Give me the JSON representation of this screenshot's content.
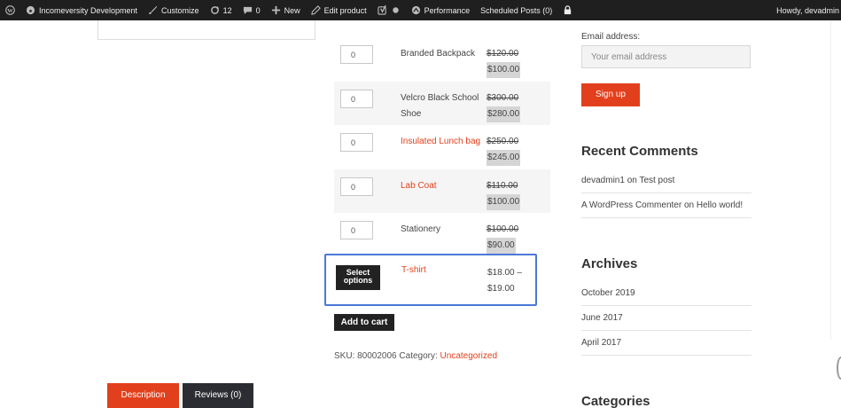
{
  "adminbar": {
    "items": [
      {
        "icon": "wordpress-icon",
        "label": ""
      },
      {
        "icon": "site-icon",
        "label": "Incomeversity Development"
      },
      {
        "icon": "brush-icon",
        "label": "Customize"
      },
      {
        "icon": "updates-icon",
        "label": "12"
      },
      {
        "icon": "comment-icon",
        "label": "0"
      },
      {
        "icon": "plus-icon",
        "label": "New"
      },
      {
        "icon": "pencil-icon",
        "label": "Edit product"
      },
      {
        "icon": "yoast-icon",
        "label": ""
      },
      {
        "icon": "dot-icon",
        "label": ""
      },
      {
        "icon": "performance-icon",
        "label": "Performance"
      },
      {
        "icon": "",
        "label": "Scheduled Posts (0)"
      },
      {
        "icon": "lock-icon",
        "label": ""
      }
    ],
    "howdy": "Howdy, devadmin"
  },
  "products": [
    {
      "qty": "0",
      "name": "Branded Backpack",
      "old_price": "$120.00",
      "new_price": "$100.00"
    },
    {
      "qty": "0",
      "name": "Velcro Black School Shoe",
      "old_price": "$300.00",
      "new_price": "$280.00"
    },
    {
      "qty": "0",
      "name": "Insulated Lunch bag",
      "old_price": "$250.00",
      "new_price": "$245.00"
    },
    {
      "qty": "0",
      "name": "Lab Coat",
      "old_price": "$110.00",
      "new_price": "$100.00"
    },
    {
      "qty": "0",
      "name": "Stationery",
      "old_price": "$100.00",
      "new_price": "$90.00"
    }
  ],
  "variable_product": {
    "button": "Select options",
    "name": "T-shirt",
    "price": "$18.00 – $19.00"
  },
  "add_to_cart": "Add to cart",
  "meta": {
    "sku_label": "SKU:",
    "sku": "80002006",
    "category_label": "Category:",
    "category": "Uncategorized"
  },
  "tabs": [
    "Description",
    "Reviews (0)"
  ],
  "sidebar": {
    "email_label": "Email address:",
    "email_placeholder": "Your email address",
    "signup": "Sign up",
    "recent_comments_title": "Recent Comments",
    "comments": [
      {
        "author": "devadmin1",
        "on": "on",
        "post": "Test post"
      },
      {
        "author": "A WordPress Commenter",
        "on": "on",
        "post": "Hello world!"
      }
    ],
    "archives_title": "Archives",
    "archives": [
      "October 2019",
      "June 2017",
      "April 2017"
    ],
    "categories_title": "Categories"
  },
  "colors": {
    "accent": "#e2401c",
    "dark": "#222222",
    "highlight_border": "#4a78d6"
  }
}
